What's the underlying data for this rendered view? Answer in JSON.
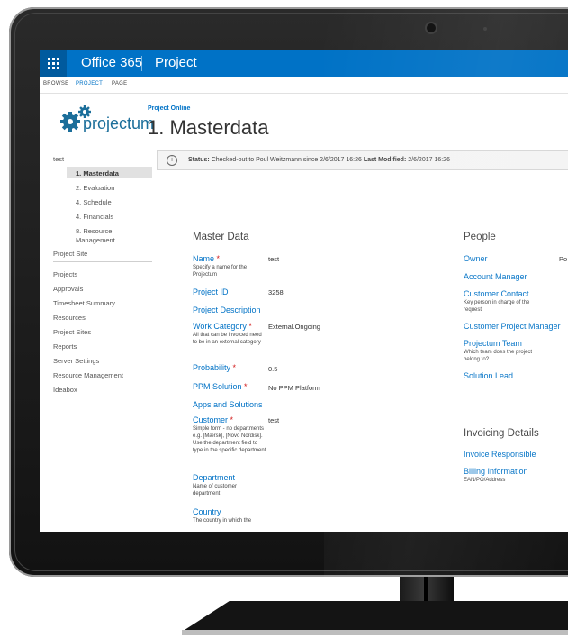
{
  "suite": {
    "name": "Office 365",
    "app": "Project"
  },
  "ribbon": {
    "tabs": [
      "BROWSE",
      "PROJECT",
      "PAGE"
    ],
    "active": "PROJECT"
  },
  "logo": {
    "text": "projectum"
  },
  "breadcrumb": "Project Online",
  "page_title": "1. Masterdata",
  "nav": {
    "project_name": "test",
    "subitems": [
      "1. Masterdata",
      "2. Evaluation",
      "4. Schedule",
      "4. Financials",
      "8. Resource Management"
    ],
    "project_site": "Project Site",
    "links": [
      "Projects",
      "Approvals",
      "Timesheet Summary",
      "Resources",
      "Project Sites",
      "Reports",
      "Server Settings",
      "Resource Management",
      "Ideabox"
    ]
  },
  "status": {
    "status_label": "Status:",
    "status_text": "Checked-out to Poul Weitzmann since 2/6/2017 16:26",
    "modified_label": "Last Modified:",
    "modified_text": "2/6/2017 16:26"
  },
  "master": {
    "title": "Master Data",
    "name_label": "Name",
    "name_hint": "Specify a name for the Projectum",
    "name_value": "test",
    "project_id_label": "Project ID",
    "project_id_value": "3258",
    "project_description_label": "Project Description",
    "work_category_label": "Work Category",
    "work_category_hint": "All that can be invoiced need to be in an external category",
    "work_category_value": "External.Ongoing",
    "probability_label": "Probability",
    "probability_value": "0.5",
    "ppm_label": "PPM Solution",
    "ppm_value": "No PPM Platform",
    "apps_label": "Apps and Solutions",
    "customer_label": "Customer",
    "customer_hint": "Simple form - no departments e.g. [Mærsk], [Novo Nordisk]. Use the department field to type in the specific department",
    "customer_value": "test",
    "department_label": "Department",
    "department_hint": "Name of customer department",
    "country_label": "Country",
    "country_hint": "The country in which the",
    "required_mark": "*"
  },
  "people": {
    "title": "People",
    "owner_label": "Owner",
    "owner_value": "Po",
    "account_manager_label": "Account Manager",
    "customer_contact_label": "Customer Contact",
    "customer_contact_hint": "Key person in charge of the request",
    "customer_pm_label": "Customer Project Manager",
    "team_label": "Projectum Team",
    "team_hint": "Which team does the project belong to?",
    "solution_lead_label": "Solution Lead"
  },
  "invoicing": {
    "title": "Invoicing Details",
    "invoice_resp_label": "Invoice Responsible",
    "billing_label": "Billing Information",
    "billing_hint": "EAN/PO/Address"
  },
  "colors": {
    "suite_bar": "#0072c6",
    "link": "#0072c6",
    "required": "#d21919",
    "logo": "#1b6e9a"
  },
  "icons": {
    "app_launcher": "waffle-icon",
    "info": "info-icon",
    "logo": "gears-icon",
    "camera": "camera-icon"
  }
}
